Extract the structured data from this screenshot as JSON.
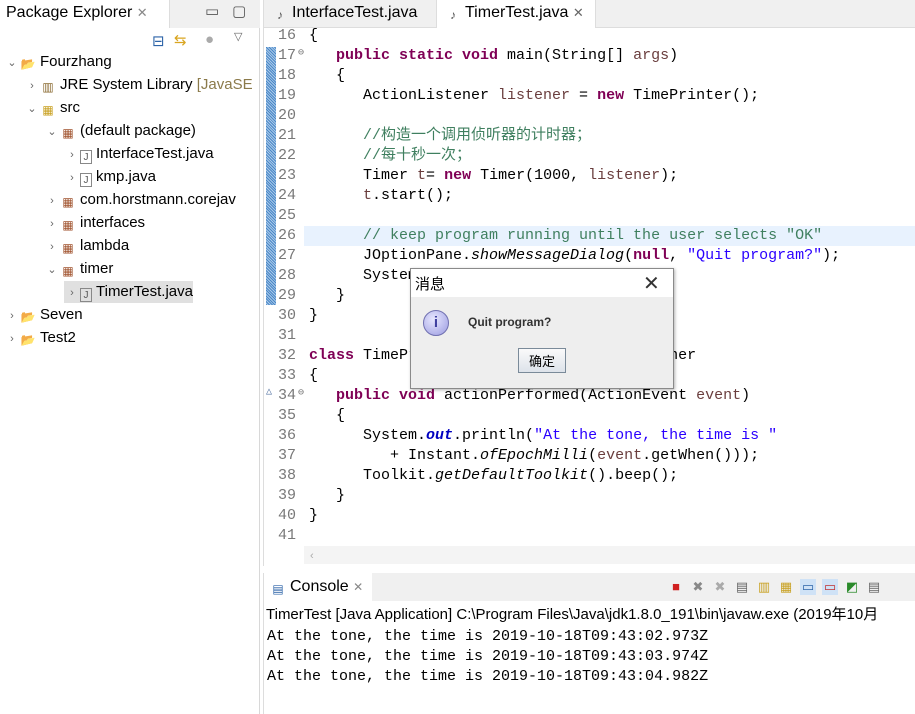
{
  "package_explorer": {
    "title": "Package Explorer",
    "tree": [
      {
        "label": "Fourzhang",
        "depth": 0,
        "exp": "open",
        "icon": "project-icon"
      },
      {
        "label": "JRE System Library",
        "suffix": "[JavaSE",
        "depth": 1,
        "exp": "closed",
        "icon": "library-icon"
      },
      {
        "label": "src",
        "depth": 1,
        "exp": "open",
        "icon": "source-folder-icon"
      },
      {
        "label": "(default package)",
        "depth": 2,
        "exp": "open",
        "icon": "package-icon"
      },
      {
        "label": "InterfaceTest.java",
        "depth": 3,
        "exp": "closed",
        "icon": "java-file-icon"
      },
      {
        "label": "kmp.java",
        "depth": 3,
        "exp": "closed",
        "icon": "java-file-icon"
      },
      {
        "label": "com.horstmann.corejav",
        "depth": 2,
        "exp": "closed",
        "icon": "package-icon"
      },
      {
        "label": "interfaces",
        "depth": 2,
        "exp": "closed",
        "icon": "package-icon"
      },
      {
        "label": "lambda",
        "depth": 2,
        "exp": "closed",
        "icon": "package-icon"
      },
      {
        "label": "timer",
        "depth": 2,
        "exp": "open",
        "icon": "package-icon"
      },
      {
        "label": "TimerTest.java",
        "depth": 3,
        "exp": "closed",
        "icon": "java-file-icon",
        "selected": true
      },
      {
        "label": "Seven",
        "depth": 0,
        "exp": "closed",
        "icon": "project-icon"
      },
      {
        "label": "Test2",
        "depth": 0,
        "exp": "closed",
        "icon": "project-icon"
      }
    ]
  },
  "editor": {
    "tabs": [
      {
        "label": "InterfaceTest.java",
        "active": false
      },
      {
        "label": "TimerTest.java",
        "active": true
      }
    ],
    "lines": [
      {
        "n": "16",
        "html": "{"
      },
      {
        "n": "17",
        "html": "   <span class=kw>public static void</span> main(String[] <span class=var>args</span>)",
        "fold": true
      },
      {
        "n": "18",
        "html": "   {"
      },
      {
        "n": "19",
        "html": "      ActionListener <span class=var>listener</span> = <span class=kw>new</span> TimePrinter();"
      },
      {
        "n": "20",
        "html": ""
      },
      {
        "n": "21",
        "html": "      <span class=cm>//构造一个调用侦听器的计时器；</span>"
      },
      {
        "n": "22",
        "html": "      <span class=cm>//每十秒一次；</span>"
      },
      {
        "n": "23",
        "html": "      Timer <span class=var>t</span>= <span class=kw>new</span> Timer(1000, <span class=var>listener</span>);"
      },
      {
        "n": "24",
        "html": "      <span class=var>t</span>.start();"
      },
      {
        "n": "25",
        "html": ""
      },
      {
        "n": "26",
        "html": "      <span class=cm>// keep program running until the user selects \"OK\"</span>",
        "current": true
      },
      {
        "n": "27",
        "html": "      JOptionPane.<span class=it>showMessageDialog</span>(<span class=kw>null</span>, <span class=st>\"Quit program?\"</span>);"
      },
      {
        "n": "28",
        "html": "      System.<span class=it>exit</span>(0);"
      },
      {
        "n": "29",
        "html": "   }"
      },
      {
        "n": "30",
        "html": "}"
      },
      {
        "n": "31",
        "html": ""
      },
      {
        "n": "32",
        "html": "<span class=kw>class</span> TimePrinter <span class=kw>implements</span> ActionListener"
      },
      {
        "n": "33",
        "html": "{"
      },
      {
        "n": "34",
        "html": "   <span class=kw>public void</span> actionPerformed(ActionEvent <span class=var>event</span>)",
        "fold": true,
        "override": true
      },
      {
        "n": "35",
        "html": "   {"
      },
      {
        "n": "36",
        "html": "      System.<span class=fld>out</span>.println(<span class=st>\"At the tone, the time is \"</span>"
      },
      {
        "n": "37",
        "html": "         + Instant.<span class=it>ofEpochMilli</span>(<span class=var>event</span>.getWhen()));"
      },
      {
        "n": "38",
        "html": "      Toolkit.<span class=it>getDefaultToolkit</span>().beep();"
      },
      {
        "n": "39",
        "html": "   }"
      },
      {
        "n": "40",
        "html": "}"
      },
      {
        "n": "41",
        "html": ""
      }
    ]
  },
  "console": {
    "title": "Console",
    "process": "TimerTest [Java Application] C:\\Program Files\\Java\\jdk1.8.0_191\\bin\\javaw.exe (2019年10月",
    "output": [
      "At the tone, the time is 2019-10-18T09:43:02.973Z",
      "At the tone, the time is 2019-10-18T09:43:03.974Z",
      "At the tone, the time is 2019-10-18T09:43:04.982Z"
    ]
  },
  "dialog": {
    "title": "消息",
    "message": "Quit program?",
    "ok_label": "确定"
  }
}
